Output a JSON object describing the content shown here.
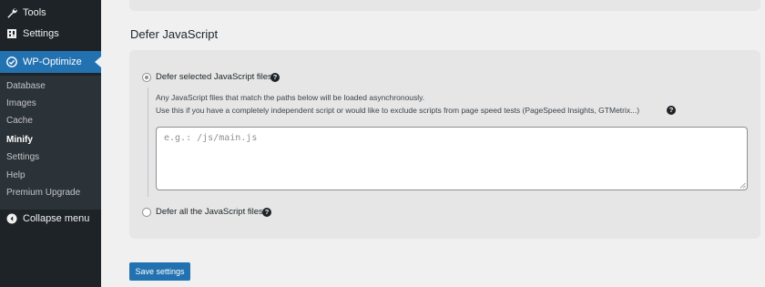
{
  "sidebar": {
    "items": [
      {
        "label": "Tools",
        "icon": "wrench-icon"
      },
      {
        "label": "Settings",
        "icon": "settings-icon"
      },
      {
        "label": "WP-Optimize",
        "icon": "wp-optimize-icon"
      }
    ],
    "submenu": [
      "Database",
      "Images",
      "Cache",
      "Minify",
      "Settings",
      "Help",
      "Premium Upgrade"
    ],
    "current_submenu": "Minify",
    "collapse_label": "Collapse menu",
    "accent_color": "#2271b1"
  },
  "main": {
    "section_title": "Defer JavaScript",
    "option_selected": {
      "label": "Defer selected JavaScript files",
      "checked": true
    },
    "description_line1": "Any JavaScript files that match the paths below will be loaded asynchronously.",
    "description_line2": "Use this if you have a completely independent script or would like to exclude scripts from page speed tests (PageSpeed Insights, GTMetrix...)",
    "textarea": {
      "placeholder": "e.g.: /js/main.js",
      "value": ""
    },
    "option_all": {
      "label": "Defer all the JavaScript files",
      "checked": false
    },
    "save_label": "Save settings"
  }
}
